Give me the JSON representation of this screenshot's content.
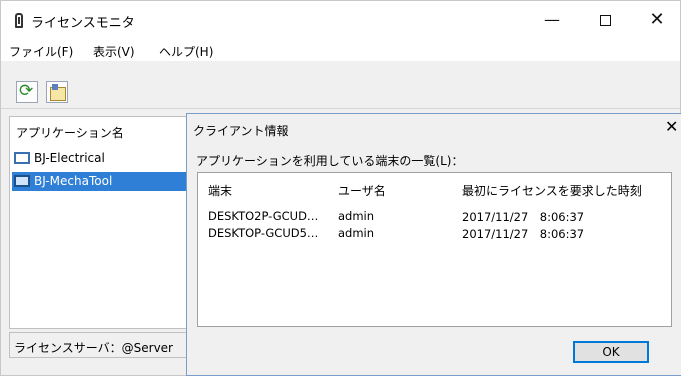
{
  "window": {
    "title": "ライセンスモニタ",
    "minimize": "—",
    "close": "✕"
  },
  "menu": {
    "file": "ファイル(F)",
    "view": "表示(V)",
    "help": "ヘルプ(H)"
  },
  "left_pane": {
    "header": "アプリケーション名",
    "items": [
      {
        "label": "BJ-Electrical",
        "selected": false
      },
      {
        "label": "BJ-MechaTool",
        "selected": true
      }
    ]
  },
  "status": {
    "text": "ライセンスサーバ：@Server"
  },
  "dialog": {
    "title": "クライアント情報",
    "close": "✕",
    "caption": "アプリケーションを利用している端末の一覧(L)：",
    "columns": [
      "端末",
      "ユーザ名",
      "最初にライセンスを要求した時刻"
    ],
    "rows": [
      [
        "DESKTO2P-GCUD…",
        "admin",
        "2017/11/27　8:06:37"
      ],
      [
        "DESKTOP-GCUD5…",
        "admin",
        "2017/11/27　8:06:37"
      ]
    ],
    "ok_label": "OK"
  },
  "icons": {
    "toolbar": [
      "refresh-icon",
      "client-info-icon"
    ],
    "app": "app-icon"
  }
}
